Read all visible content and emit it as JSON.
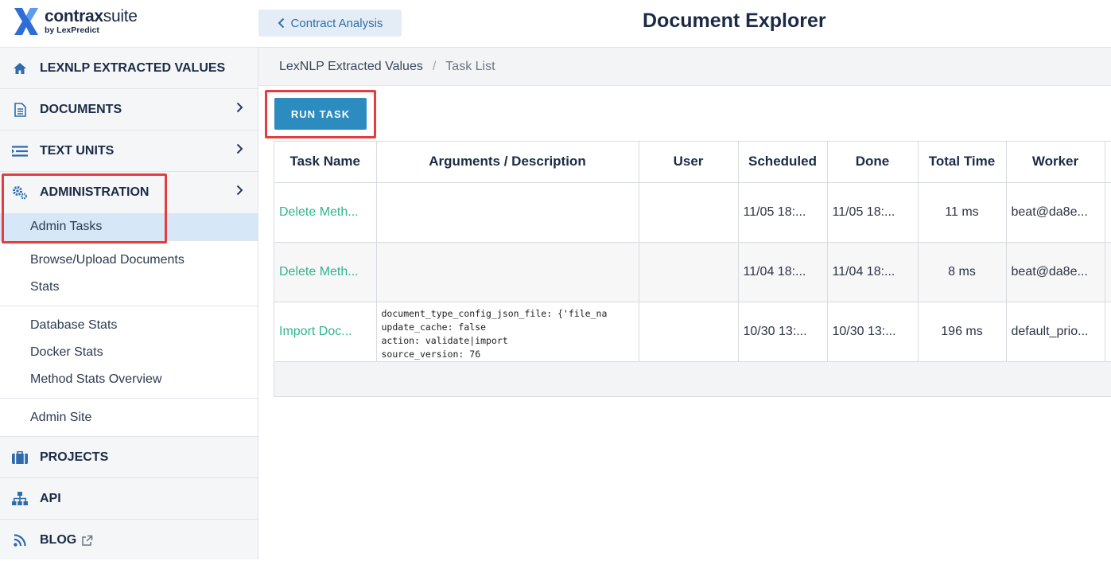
{
  "brand": {
    "name_bold": "contrax",
    "name_thin": "suite",
    "byline": "by LexPredict"
  },
  "header": {
    "back_label": "Contract Analysis",
    "title": "Document Explorer"
  },
  "sidebar": {
    "main_items": [
      {
        "label": "LEXNLP EXTRACTED VALUES",
        "icon": "home-icon"
      },
      {
        "label": "DOCUMENTS",
        "icon": "document-icon"
      },
      {
        "label": "TEXT UNITS",
        "icon": "list-icon"
      },
      {
        "label": "ADMINISTRATION",
        "icon": "gears-icon"
      },
      {
        "label": "PROJECTS",
        "icon": "briefcase-icon"
      },
      {
        "label": "API",
        "icon": "sitemap-icon"
      },
      {
        "label": "BLOG",
        "icon": "rss-icon"
      }
    ],
    "admin_groups": [
      [
        "Admin Tasks"
      ],
      [
        "Browse/Upload Documents",
        "Stats"
      ],
      [
        "Database Stats",
        "Docker Stats",
        "Method Stats Overview"
      ],
      [
        "Admin Site"
      ]
    ]
  },
  "breadcrumb": {
    "root": "LexNLP Extracted Values",
    "separator": "/",
    "current": "Task List"
  },
  "toolbar": {
    "run_task_label": "RUN TASK"
  },
  "table": {
    "columns": [
      "Task Name",
      "Arguments / Description",
      "User",
      "Scheduled",
      "Done",
      "Total Time",
      "Worker"
    ],
    "rows": [
      {
        "name": "Delete Meth...",
        "args": "",
        "user": "",
        "scheduled": "11/05 18:...",
        "done": "11/05 18:...",
        "total": "11 ms",
        "worker": "beat@da8e..."
      },
      {
        "name": "Delete Meth...",
        "args": "",
        "user": "",
        "scheduled": "11/04 18:...",
        "done": "11/04 18:...",
        "total": "8 ms",
        "worker": "beat@da8e..."
      },
      {
        "name": "Import Doc...",
        "args_lines": [
          "document_type_config_json_file: {'file_na",
          "update_cache: false",
          "action: validate|import",
          "source_version: 76"
        ],
        "user": "",
        "scheduled": "10/30 13:...",
        "done": "10/30 13:...",
        "total": "196 ms",
        "worker": "default_prio..."
      }
    ]
  },
  "colors": {
    "accent": "#2c8bbf",
    "link": "#2fb58f",
    "highlight": "#e43d3d",
    "active_row": "#d6e7f7"
  }
}
